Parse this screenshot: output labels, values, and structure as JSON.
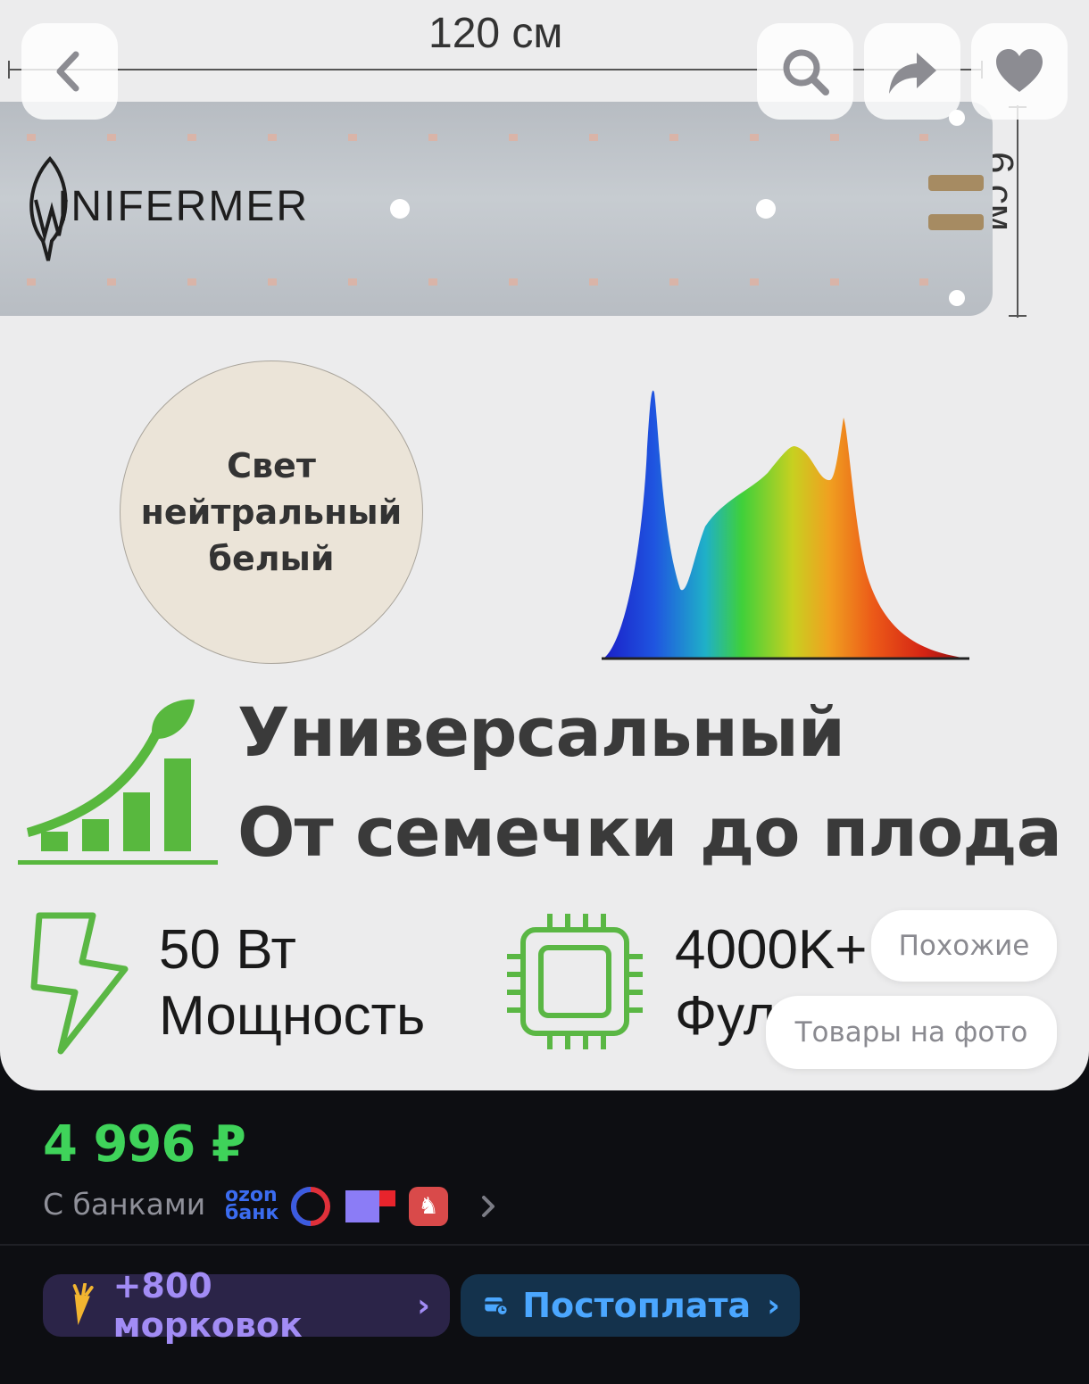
{
  "photo": {
    "width_label": "120 см",
    "height_label": "6 см",
    "brand": "INIFERMER",
    "circle_lines": [
      "Свет",
      "нейтральный",
      "белый"
    ],
    "headline_1": "Универсальный",
    "headline_2": "От семечки до плода",
    "spec_power_value": "50 Вт",
    "spec_power_label": "Мощность",
    "spec_temp_value": "4000K+",
    "spec_temp_label": "Фул",
    "similar_button": "Похожие",
    "products_on_photo_button": "Товары на фото"
  },
  "nav": {
    "back_icon": "chevron-left-icon",
    "search_icon": "search-icon",
    "share_icon": "share-icon",
    "favorite_icon": "heart-icon"
  },
  "pricing": {
    "price": "4 996 ₽",
    "banks_label": "С банками",
    "ozon_bank_line1": "ozon",
    "ozon_bank_line2": "банк"
  },
  "chips": {
    "carrots": "+800 морковок",
    "postpay": "Постоплата"
  },
  "colors": {
    "price_green": "#3fd35a",
    "carrot_chip_bg": "#2b2448",
    "carrot_chip_text": "#a28cf5",
    "postpay_chip_bg": "#14324c",
    "postpay_chip_text": "#4ba7ff",
    "page_bg": "#0d0e12"
  }
}
